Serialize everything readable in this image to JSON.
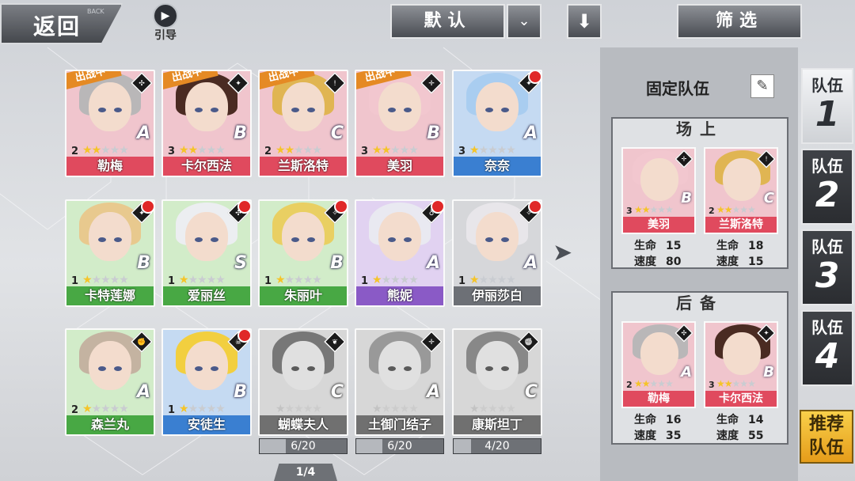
{
  "header": {
    "back_label": "返回",
    "back_sub": "BACK",
    "guide_label": "引导",
    "sort_label": "默认",
    "filter_label": "筛选"
  },
  "roster": {
    "page": "1/4",
    "battle_tag": "出战中",
    "cards": [
      {
        "name": "勒梅",
        "level": "2",
        "stars": 2,
        "rank": "A",
        "color": "red",
        "in_battle": true,
        "dot": false,
        "greyed": false,
        "hair": "#b9b7b8",
        "cls": "✣"
      },
      {
        "name": "卡尔西法",
        "level": "3",
        "stars": 2,
        "rank": "B",
        "color": "red",
        "in_battle": true,
        "dot": false,
        "greyed": false,
        "hair": "#4a2b22",
        "cls": "✦"
      },
      {
        "name": "兰斯洛特",
        "level": "2",
        "stars": 2,
        "rank": "C",
        "color": "red",
        "in_battle": true,
        "dot": false,
        "greyed": false,
        "hair": "#e0b552",
        "cls": "!"
      },
      {
        "name": "美羽",
        "level": "3",
        "stars": 2,
        "rank": "B",
        "color": "red",
        "in_battle": true,
        "dot": false,
        "greyed": false,
        "hair": "#f2c7cf",
        "cls": "✛"
      },
      {
        "name": "奈奈",
        "level": "3",
        "stars": 1,
        "rank": "A",
        "color": "blue",
        "in_battle": false,
        "dot": true,
        "greyed": false,
        "hair": "#a9cdf0",
        "cls": "✦"
      },
      {
        "name": "卡特莲娜",
        "level": "1",
        "stars": 1,
        "rank": "B",
        "color": "green",
        "in_battle": false,
        "dot": true,
        "greyed": false,
        "hair": "#e8c98e",
        "cls": "✦"
      },
      {
        "name": "爱丽丝",
        "level": "1",
        "stars": 1,
        "rank": "S",
        "color": "green",
        "in_battle": false,
        "dot": true,
        "greyed": false,
        "hair": "#eceef1",
        "cls": "✣"
      },
      {
        "name": "朱丽叶",
        "level": "1",
        "stars": 1,
        "rank": "B",
        "color": "green",
        "in_battle": false,
        "dot": true,
        "greyed": false,
        "hair": "#e9cf62",
        "cls": "✧"
      },
      {
        "name": "熊妮",
        "level": "1",
        "stars": 1,
        "rank": "A",
        "color": "purple",
        "in_battle": false,
        "dot": true,
        "greyed": false,
        "hair": "#e9e9f1",
        "cls": "♁"
      },
      {
        "name": "伊丽莎白",
        "level": "1",
        "stars": 1,
        "rank": "A",
        "color": "grey",
        "in_battle": false,
        "dot": true,
        "greyed": false,
        "hair": "#e8e6ea",
        "cls": "✧"
      },
      {
        "name": "森兰丸",
        "level": "2",
        "stars": 1,
        "rank": "A",
        "color": "green",
        "in_battle": false,
        "dot": false,
        "greyed": false,
        "hair": "#c4b3a1",
        "cls": "✊"
      },
      {
        "name": "安徒生",
        "level": "1",
        "stars": 1,
        "rank": "B",
        "color": "blue",
        "in_battle": false,
        "dot": true,
        "greyed": false,
        "hair": "#f2cf3f",
        "cls": "☠"
      },
      {
        "name": "蝴蝶夫人",
        "level": "",
        "stars": 1,
        "rank": "C",
        "color": "grey",
        "in_battle": false,
        "dot": false,
        "greyed": true,
        "hair": "#777",
        "cls": "❦",
        "fragments": "6/20",
        "frag_fill": 0.3
      },
      {
        "name": "土御门结子",
        "level": "",
        "stars": 1,
        "rank": "A",
        "color": "grey",
        "in_battle": false,
        "dot": false,
        "greyed": true,
        "hair": "#999",
        "cls": "✛",
        "fragments": "6/20",
        "frag_fill": 0.3
      },
      {
        "name": "康斯坦丁",
        "level": "",
        "stars": 1,
        "rank": "C",
        "color": "grey",
        "in_battle": false,
        "dot": false,
        "greyed": true,
        "hair": "#888",
        "cls": "✊",
        "fragments": "4/20",
        "frag_fill": 0.2
      }
    ]
  },
  "team": {
    "fixed_title": "固定队伍",
    "onfield_title": "场上",
    "reserve_title": "后备",
    "hp_label": "生命",
    "speed_label": "速度",
    "onfield": [
      {
        "name": "美羽",
        "level": "3",
        "stars": 2,
        "rank": "B",
        "hp": "15",
        "speed": "80",
        "hair": "#f2c7cf",
        "cls": "✛"
      },
      {
        "name": "兰斯洛特",
        "level": "2",
        "stars": 2,
        "rank": "C",
        "hp": "18",
        "speed": "15",
        "hair": "#e0b552",
        "cls": "!"
      }
    ],
    "reserve": [
      {
        "name": "勒梅",
        "level": "2",
        "stars": 2,
        "rank": "A",
        "hp": "16",
        "speed": "35",
        "hair": "#b9b7b8",
        "cls": "✣"
      },
      {
        "name": "卡尔西法",
        "level": "3",
        "stars": 2,
        "rank": "B",
        "hp": "14",
        "speed": "55",
        "hair": "#4a2b22",
        "cls": "✦"
      }
    ],
    "tabs": [
      {
        "label": "队伍",
        "num": "1",
        "active": true
      },
      {
        "label": "队伍",
        "num": "2",
        "active": false
      },
      {
        "label": "队伍",
        "num": "3",
        "active": false
      },
      {
        "label": "队伍",
        "num": "4",
        "active": false
      }
    ],
    "recommend_label": "推荐队伍"
  }
}
